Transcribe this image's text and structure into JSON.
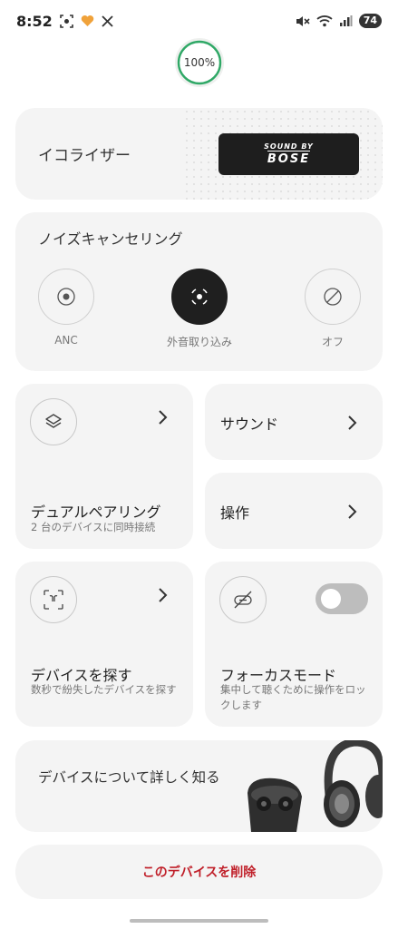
{
  "status_bar": {
    "time": "8:52",
    "battery": "74"
  },
  "device": {
    "battery_percent": 100,
    "battery_label": "100%"
  },
  "equalizer": {
    "label": "イコライザー",
    "badge_top": "SOUND BY",
    "badge_main": "BOSE"
  },
  "noise_cancelling": {
    "title": "ノイズキャンセリング",
    "options": [
      {
        "label": "ANC",
        "active": false
      },
      {
        "label": "外音取り込み",
        "active": true
      },
      {
        "label": "オフ",
        "active": false
      }
    ]
  },
  "tiles": {
    "dual_pairing": {
      "title": "デュアルペアリング",
      "subtitle": "2 台のデバイスに同時接続"
    },
    "sound": {
      "title": "サウンド"
    },
    "controls": {
      "title": "操作"
    },
    "find_device": {
      "title": "デバイスを探す",
      "subtitle": "数秒で紛失したデバイスを探す"
    },
    "focus_mode": {
      "title": "フォーカスモード",
      "subtitle": "集中して聴くために操作をロックします",
      "enabled": false
    }
  },
  "learn_more": {
    "label": "デバイスについて詳しく知る"
  },
  "delete": {
    "label": "このデバイスを削除"
  }
}
